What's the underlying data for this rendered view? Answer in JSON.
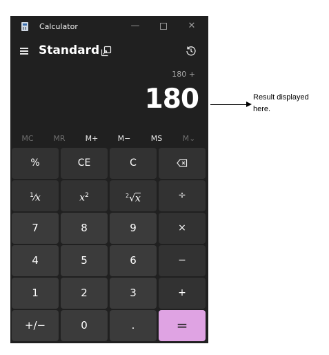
{
  "window": {
    "title": "Calculator"
  },
  "header": {
    "mode": "Standard"
  },
  "display": {
    "expression": "180 +",
    "result": "180"
  },
  "memory": [
    "MC",
    "MR",
    "M+",
    "M−",
    "MS",
    "M⌄"
  ],
  "keys": {
    "percent": "%",
    "ce": "CE",
    "c": "C",
    "reciprocal_num": "1",
    "reciprocal_den": "x",
    "square_base": "x",
    "square_exp": "2",
    "sqrt_index": "2",
    "sqrt_sym": "√",
    "sqrt_var": "x",
    "divide": "÷",
    "multiply": "×",
    "minus": "−",
    "plus": "+",
    "equals": "=",
    "seven": "7",
    "eight": "8",
    "nine": "9",
    "four": "4",
    "five": "5",
    "six": "6",
    "one": "1",
    "two": "2",
    "three": "3",
    "negate": "+/−",
    "zero": "0",
    "decimal": "."
  },
  "annotation": {
    "text": "Result displayed here."
  },
  "colors": {
    "equals_key": "#dfa3e3",
    "window_bg": "#202020",
    "key_bg": "#3b3b3b"
  },
  "icons": [
    "calculator-app-icon",
    "minimize-icon",
    "maximize-icon",
    "close-icon",
    "hamburger-menu-icon",
    "keep-on-top-icon",
    "history-icon",
    "backspace-icon"
  ]
}
